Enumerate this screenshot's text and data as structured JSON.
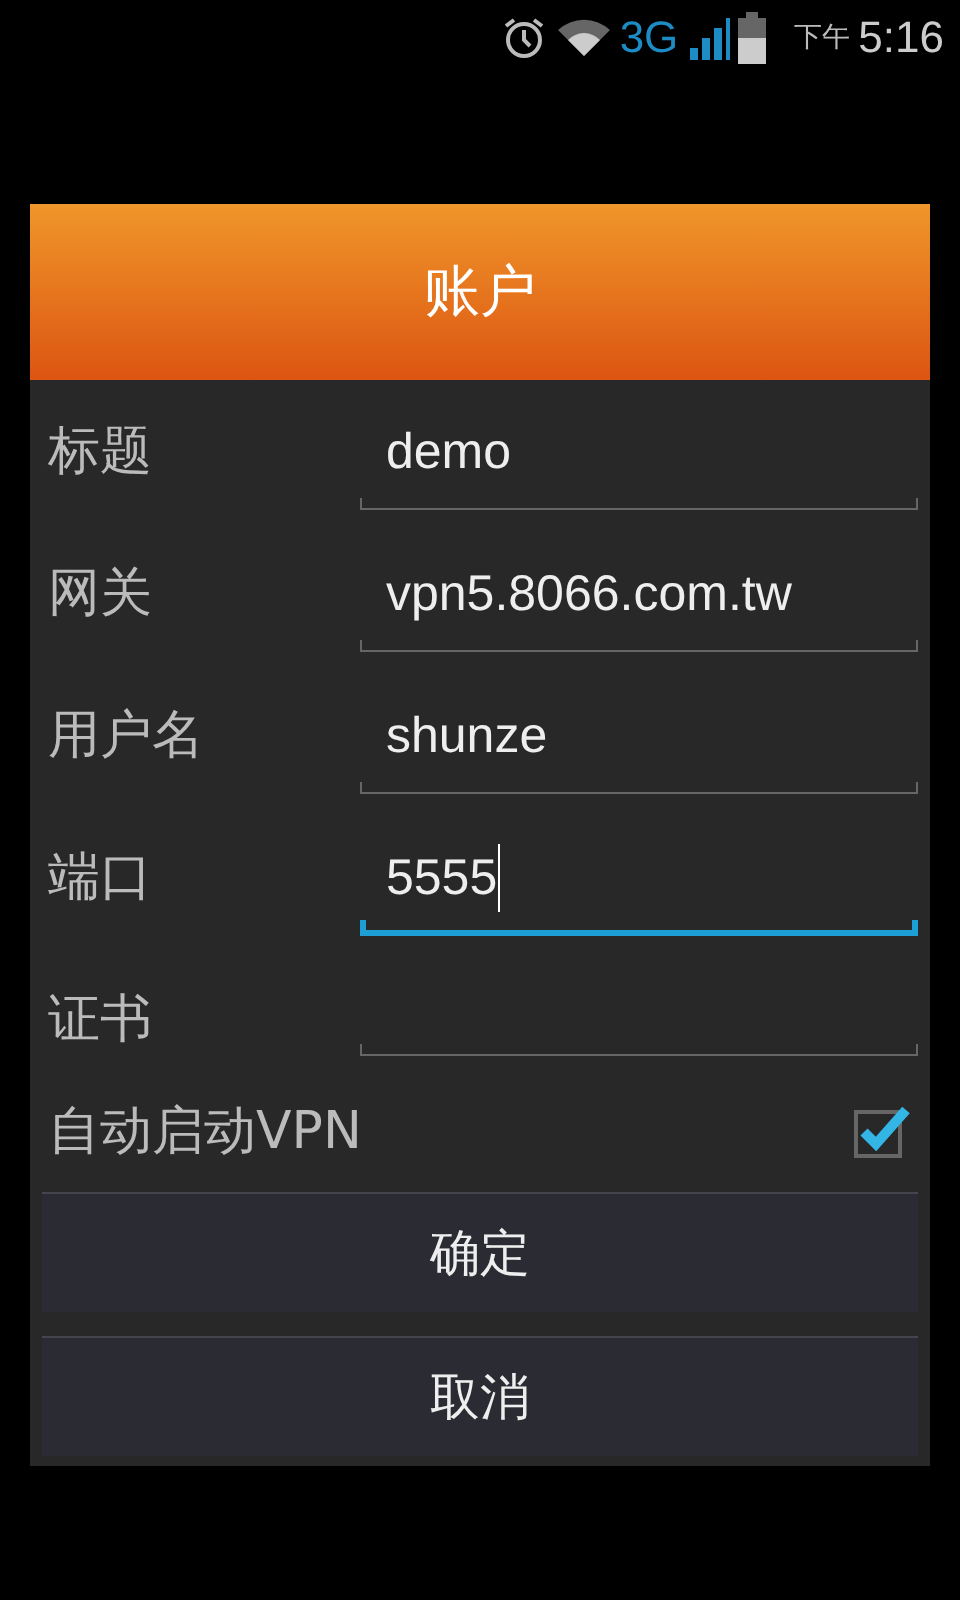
{
  "status_bar": {
    "network": "3G",
    "time_prefix": "下午",
    "time": "5:16"
  },
  "dialog": {
    "title": "账户",
    "fields": [
      {
        "label": "标题",
        "value": "demo",
        "focused": false
      },
      {
        "label": "网关",
        "value": "vpn5.8066.com.tw",
        "focused": false
      },
      {
        "label": "用户名",
        "value": "shunze",
        "focused": false
      },
      {
        "label": "端口",
        "value": "5555",
        "focused": true
      },
      {
        "label": "证书",
        "focused": false
      }
    ],
    "checkbox": {
      "label": "自动启动VPN",
      "checked": true
    },
    "buttons": [
      "确定",
      "取消"
    ]
  }
}
